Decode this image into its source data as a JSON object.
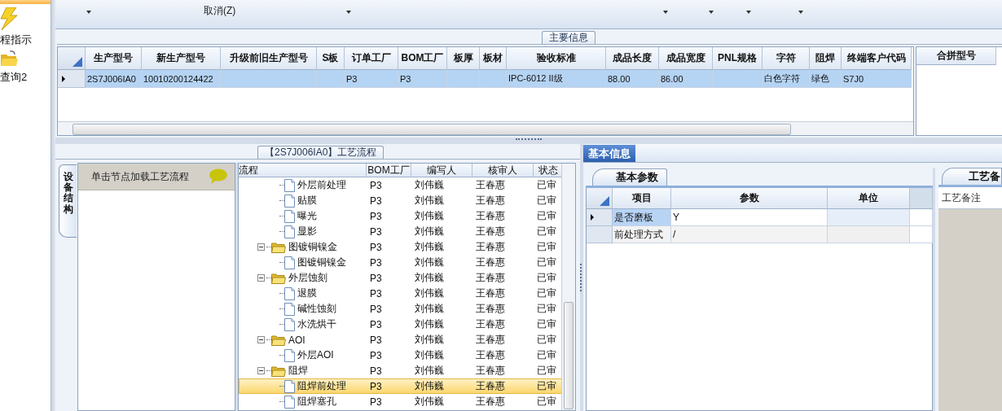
{
  "sidebar": {
    "items": [
      {
        "label": "程指示"
      },
      {
        "label": "查询2"
      }
    ]
  },
  "toolbar": {
    "items": [
      {
        "kind": "caret"
      },
      {
        "kind": "label",
        "text": "取消(Z)"
      },
      {
        "kind": "caret"
      },
      {
        "kind": "caret"
      },
      {
        "kind": "caret"
      },
      {
        "kind": "caret"
      },
      {
        "kind": "caret"
      }
    ]
  },
  "main_info": {
    "title": "主要信息",
    "columns": [
      "生产型号",
      "新生产型号",
      "升级前旧生产型号",
      "S板",
      "订单工厂",
      "BOM工厂",
      "板厚",
      "板材",
      "验收标准",
      "成品长度",
      "成品宽度",
      "PNL规格",
      "字符",
      "阻焊",
      "终端客户代码"
    ],
    "rows": [
      {
        "selected": true,
        "cells": [
          "2S7J006IA0",
          "10010200124422",
          null,
          null,
          "P3",
          "P3",
          null,
          null,
          "IPC-6012 II级",
          "88.00",
          "86.00",
          null,
          "白色字符",
          "绿色",
          "S7J0"
        ]
      }
    ]
  },
  "merge_grid": {
    "columns": [
      "合拼型号"
    ]
  },
  "process_panel": {
    "title": "【2S7J006IA0】工艺流程",
    "side_tab": {
      "label": "设备结构",
      "selected": true
    },
    "tree_hint": "单击节点加载工艺流程",
    "columns": [
      "流程",
      "BOM工厂",
      "编写人",
      "核审人",
      "状态"
    ],
    "rows": [
      {
        "children": [
          {
            "label": "外层前处理",
            "bom": "P3",
            "writer": "刘伟巍",
            "reviewer": "王春惠",
            "status": "已审",
            "selected": false
          },
          {
            "label": "贴膜",
            "bom": "P3",
            "writer": "刘伟巍",
            "reviewer": "王春惠",
            "status": "已审",
            "selected": false
          },
          {
            "label": "曝光",
            "bom": "P3",
            "writer": "刘伟巍",
            "reviewer": "王春惠",
            "status": "已审",
            "selected": false
          },
          {
            "label": "显影",
            "bom": "P3",
            "writer": "刘伟巍",
            "reviewer": "王春惠",
            "status": "已审",
            "selected": false
          }
        ]
      },
      {
        "label": "图镀铜镍金",
        "bom": "P3",
        "writer": "刘伟巍",
        "reviewer": "王春惠",
        "status": "已审",
        "selected": false,
        "expanded": true,
        "children": [
          {
            "label": "图镀铜镍金",
            "bom": "P3",
            "writer": "刘伟巍",
            "reviewer": "王春惠",
            "status": "已审",
            "selected": false
          }
        ]
      },
      {
        "label": "外层蚀刻",
        "bom": "P3",
        "writer": "刘伟巍",
        "reviewer": "王春惠",
        "status": "已审",
        "selected": false,
        "expanded": true,
        "children": [
          {
            "label": "退膜",
            "bom": "P3",
            "writer": "刘伟巍",
            "reviewer": "王春惠",
            "status": "已审",
            "selected": false
          },
          {
            "label": "碱性蚀刻",
            "bom": "P3",
            "writer": "刘伟巍",
            "reviewer": "王春惠",
            "status": "已审",
            "selected": false
          },
          {
            "label": "水洗烘干",
            "bom": "P3",
            "writer": "刘伟巍",
            "reviewer": "王春惠",
            "status": "已审",
            "selected": false
          }
        ]
      },
      {
        "label": "AOI",
        "bom": "P3",
        "writer": "刘伟巍",
        "reviewer": "王春惠",
        "status": "已审",
        "selected": false,
        "expanded": true,
        "children": [
          {
            "label": "外层AOI",
            "bom": "P3",
            "writer": "刘伟巍",
            "reviewer": "王春惠",
            "status": "已审",
            "selected": false
          }
        ]
      },
      {
        "label": "阻焊",
        "bom": "P3",
        "writer": "刘伟巍",
        "reviewer": "王春惠",
        "status": "已审",
        "selected": false,
        "expanded": true,
        "children": [
          {
            "label": "阻焊前处理",
            "bom": "P3",
            "writer": "刘伟巍",
            "reviewer": "王春惠",
            "status": "已审",
            "selected": true
          },
          {
            "label": "阻焊塞孔",
            "bom": "P3",
            "writer": "刘伟巍",
            "reviewer": "王春惠",
            "status": "已审",
            "selected": false
          }
        ]
      }
    ]
  },
  "info_panel": {
    "tabs": [
      {
        "label": "基本信息",
        "selected": true
      }
    ],
    "sub_tabs": [
      {
        "label": "基本参数",
        "selected": true
      }
    ],
    "columns": [
      "项目",
      "参数",
      "单位"
    ],
    "rows": [
      {
        "selected": true,
        "item": "是否磨板",
        "param": "Y"
      },
      {
        "selected": false,
        "item": "前处理方式",
        "param": "/"
      }
    ],
    "note_tab": {
      "label": "工艺备"
    },
    "note_label": "工艺备注"
  }
}
